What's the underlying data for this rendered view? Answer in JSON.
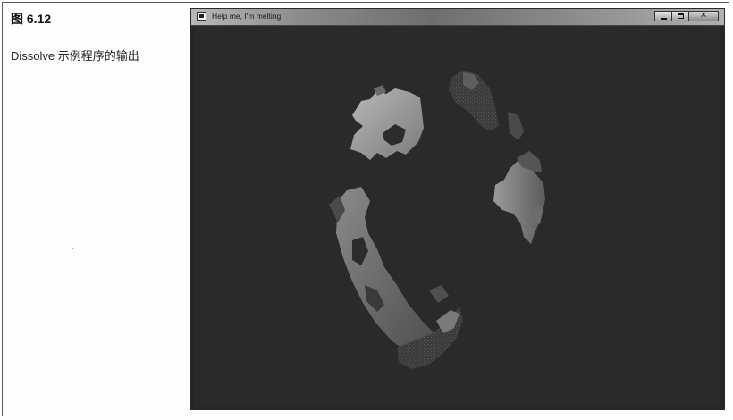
{
  "figure": {
    "title": "图 6.12",
    "caption": "Dissolve 示例程序的输出"
  },
  "window": {
    "title": "Help me, I'm melting!",
    "controls": {
      "minimize": "minimize",
      "maximize": "maximize",
      "close": "close"
    }
  },
  "viewport": {
    "background": "#2a2a2a",
    "object": "dissolving-globe"
  },
  "icons": [
    "app-icon",
    "minimize-icon",
    "maximize-icon",
    "close-icon"
  ]
}
